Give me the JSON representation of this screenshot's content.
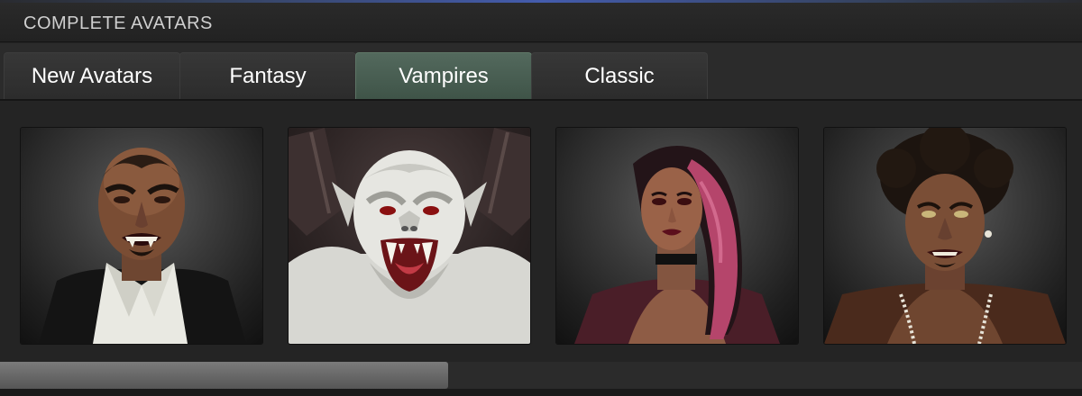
{
  "panel": {
    "title": "COMPLETE AVATARS"
  },
  "tabs": [
    {
      "label": "New Avatars",
      "active": false
    },
    {
      "label": "Fantasy",
      "active": false
    },
    {
      "label": "Vampires",
      "active": true
    },
    {
      "label": "Classic",
      "active": false
    }
  ],
  "avatars": [
    {
      "name": "vampire-bald-man"
    },
    {
      "name": "vampire-gargoyle"
    },
    {
      "name": "vampire-woman"
    },
    {
      "name": "vampire-afro-man"
    }
  ],
  "scroll": {
    "position_fraction": 0.0,
    "thumb_fraction": 0.41
  },
  "colors": {
    "active_tab": "#4a5f53",
    "background": "#232323",
    "header_text": "#cfcfcf"
  }
}
